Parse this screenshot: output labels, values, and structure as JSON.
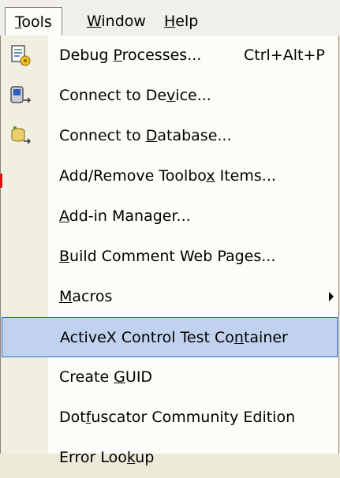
{
  "menubar": {
    "items": [
      {
        "label": "Tools",
        "accel": "T",
        "rest": "ools",
        "active": true
      },
      {
        "label": "Window",
        "accel": "W",
        "rest": "indow"
      },
      {
        "label": "Help",
        "accel": "H",
        "rest": "elp"
      }
    ]
  },
  "tools_menu": {
    "items": [
      {
        "pre": "Debug ",
        "accel": "P",
        "post": "rocesses...",
        "shortcut": "Ctrl+Alt+P",
        "icon": "debug-processes-icon"
      },
      {
        "pre": "Connect to De",
        "accel": "v",
        "post": "ice...",
        "icon": "connect-device-icon"
      },
      {
        "pre": "Connect to ",
        "accel": "D",
        "post": "atabase...",
        "icon": "connect-database-icon"
      },
      {
        "pre": "Add/Remove Toolbo",
        "accel": "x",
        "post": " Items..."
      },
      {
        "pre": "",
        "accel": "A",
        "post": "dd-in Manager..."
      },
      {
        "pre": "",
        "accel": "B",
        "post": "uild Comment Web Pages..."
      },
      {
        "pre": "",
        "accel": "M",
        "post": "acros",
        "submenu": true
      },
      {
        "pre": "ActiveX Control Test Co",
        "accel": "n",
        "post": "tainer",
        "highlighted": true
      },
      {
        "pre": "Create ",
        "accel": "G",
        "post": "UID"
      },
      {
        "pre": "Dot",
        "accel": "f",
        "post": "uscator Community Edition"
      },
      {
        "pre": "Error Loo",
        "accel": "k",
        "post": "up"
      }
    ]
  },
  "colors": {
    "highlight_fill": "#c1d2ee",
    "highlight_border": "#316ac5",
    "menu_background": "#fcfcf9",
    "gutter": "#f1efe2"
  }
}
